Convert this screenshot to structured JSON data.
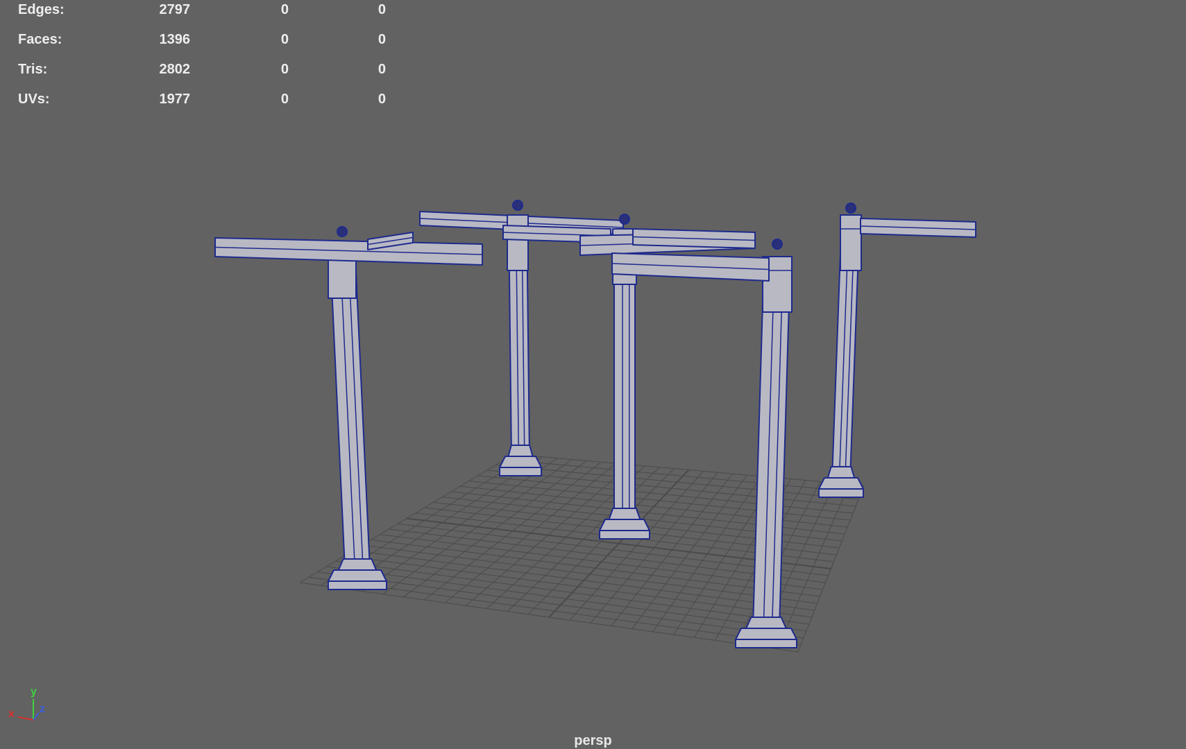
{
  "hud": {
    "stats": [
      {
        "label": "Edges:",
        "values": [
          "2797",
          "0",
          "0"
        ]
      },
      {
        "label": "Faces:",
        "values": [
          "1396",
          "0",
          "0"
        ]
      },
      {
        "label": "Tris:",
        "values": [
          "2802",
          "0",
          "0"
        ]
      },
      {
        "label": "UVs:",
        "values": [
          "1977",
          "0",
          "0"
        ]
      }
    ]
  },
  "viewport": {
    "camera": "persp",
    "background_color": "#626262",
    "grid_color": "#4a4a4a",
    "wireframe_color": "#1e2a8c",
    "mesh_color": "#b9b9c4"
  },
  "axis_indicator": {
    "x": "x",
    "y": "y",
    "z": "z",
    "x_color": "#d8302a",
    "y_color": "#3fd03f",
    "z_color": "#3a5ce0"
  }
}
